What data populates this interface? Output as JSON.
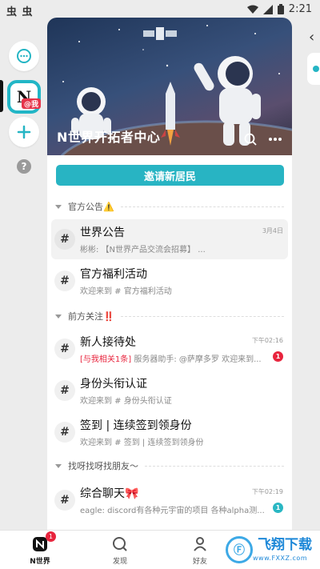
{
  "status_bar": {
    "left_icons": "虫 虫",
    "time": "2:21"
  },
  "rail": {
    "avatar_letter": "N",
    "avatar_tag": "@我",
    "help_label": "?"
  },
  "banner": {
    "title": "N世界开拓者中心"
  },
  "invite_button": "邀请新居民",
  "sections": [
    {
      "title": "官方公告⚠️"
    },
    {
      "title": "前方关注‼️"
    },
    {
      "title": "找呀找呀找朋友～"
    }
  ],
  "channels": [
    {
      "name": "世界公告",
      "preview": "彬彬: 【N世界产品交流会招募】 ...",
      "date": "3月4日",
      "active": true
    },
    {
      "name": "官方福利活动",
      "preview": "欢迎来到 # 官方福利活动"
    },
    {
      "name": "新人接待处",
      "mention": "[与我相关1条]",
      "preview": " 服务器助手: @萨摩多罗 欢迎来到...",
      "date": "下午02:16",
      "badge": "1",
      "badge_color": "#e8243d"
    },
    {
      "name": "身份头衔认证",
      "preview": "欢迎来到 # 身份头衔认证"
    },
    {
      "name": "签到 | 连续签到领身份",
      "preview": "欢迎来到 # 签到 | 连续签到领身份"
    },
    {
      "name": "综合聊天🎀",
      "preview": "eagle: discord有各种元宇宙的项目 各种alpha测...",
      "date": "下午02:19",
      "badge": "1",
      "badge_color": "#2ab7c3"
    }
  ],
  "bottom_nav": [
    {
      "label": "N世界",
      "icon": "n-world-icon",
      "badge": "1"
    },
    {
      "label": "发现",
      "icon": "discover-icon"
    },
    {
      "label": "好友",
      "icon": "friends-icon"
    }
  ],
  "watermark": {
    "main": "飞翔下载",
    "sub": "www.FXXZ.com",
    "logo": "Ⓕ"
  }
}
